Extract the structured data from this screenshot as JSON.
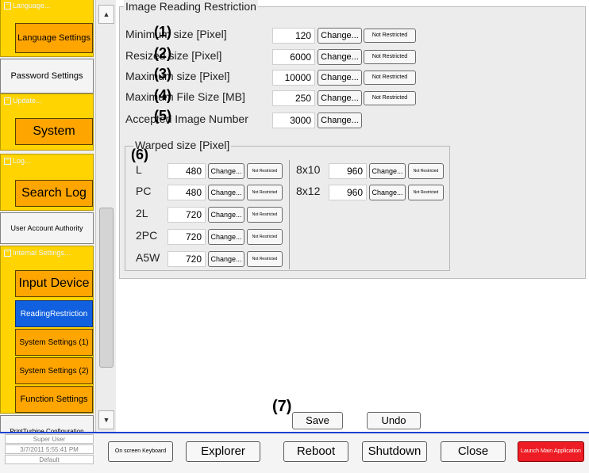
{
  "sidebar": {
    "categories": [
      {
        "header": "Language...",
        "button": "Language Settings"
      },
      {
        "header": "Update...",
        "button": "System"
      },
      {
        "header": "Log...",
        "button": "Search Log"
      },
      {
        "header": "Internal Settings...",
        "buttons": [
          "Input Device",
          "ReadingRestriction",
          "System Settings (1)",
          "System Settings (2)",
          "Function Settings"
        ]
      }
    ],
    "gray_buttons": [
      "Password Settings",
      "User Account Authority",
      "PrintTurbine Configuration"
    ],
    "selected": "ReadingRestriction",
    "expand_glyph": "−"
  },
  "scrollbar": {
    "up_glyph": "▲",
    "down_glyph": "▼"
  },
  "restriction": {
    "legend": "Image Reading Restriction",
    "rows": [
      {
        "label": "Minimum size [Pixel]",
        "value": "120",
        "change": "Change...",
        "not_restricted": "Not Restricted",
        "anno": "(1)"
      },
      {
        "label": "Resized size [Pixel]",
        "value": "6000",
        "change": "Change...",
        "not_restricted": "Not Restricted",
        "anno": "(2)"
      },
      {
        "label": "Maximum size [Pixel]",
        "value": "10000",
        "change": "Change...",
        "not_restricted": "Not Restricted",
        "anno": "(3)"
      },
      {
        "label": "Maximum File Size [MB]",
        "value": "250",
        "change": "Change...",
        "not_restricted": "Not Restricted",
        "anno": "(4)"
      },
      {
        "label": "Accepted Image Number",
        "value": "3000",
        "change": "Change...",
        "anno": "(5)"
      }
    ]
  },
  "warped": {
    "legend": "Warped size [Pixel]",
    "anno": "(6)",
    "left_rows": [
      {
        "label": "L",
        "value": "480",
        "change": "Change...",
        "not_restricted": "Not Restricted"
      },
      {
        "label": "PC",
        "value": "480",
        "change": "Change...",
        "not_restricted": "Not Restricted"
      },
      {
        "label": "2L",
        "value": "720",
        "change": "Change...",
        "not_restricted": "Not Restricted"
      },
      {
        "label": "2PC",
        "value": "720",
        "change": "Change...",
        "not_restricted": "Not Restricted"
      },
      {
        "label": "A5W",
        "value": "720",
        "change": "Change...",
        "not_restricted": "Not Restricted"
      }
    ],
    "right_rows": [
      {
        "label": "8x10",
        "value": "960",
        "change": "Change...",
        "not_restricted": "Not Restricted"
      },
      {
        "label": "8x12",
        "value": "960",
        "change": "Change...",
        "not_restricted": "Not Restricted"
      }
    ]
  },
  "actions": {
    "anno": "(7)",
    "save": "Save",
    "undo": "Undo"
  },
  "status": {
    "user": "Super User",
    "datetime": "3/7/2011 5:55:41 PM",
    "profile": "Default"
  },
  "bottom": {
    "keyboard": "On screen Keyboard",
    "explorer": "Explorer",
    "reboot": "Reboot",
    "shutdown": "Shutdown",
    "close": "Close",
    "launch": "Launch Main Application"
  },
  "colors": {
    "category": "#ffd400",
    "button": "#ffa500",
    "selected": "#1060e0",
    "launch": "#ee1c24",
    "bottom_border": "#1f3fd0"
  }
}
